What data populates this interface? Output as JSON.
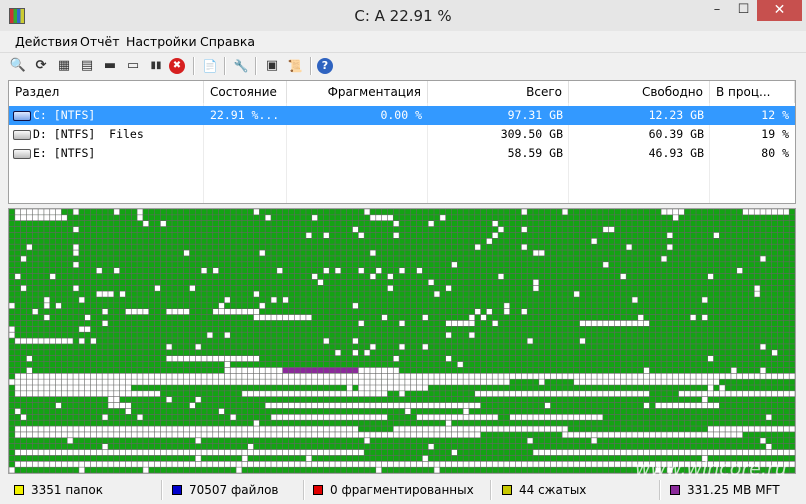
{
  "window": {
    "title": "C:  A  22.91 %",
    "minimize_glyph": "–",
    "maximize_glyph": "☐",
    "close_glyph": "✕"
  },
  "menu": [
    "Действия",
    "Отчёт",
    "Настройки",
    "Справка"
  ],
  "toolbar": {
    "icons": [
      "search-icon",
      "refresh-icon",
      "defrag-icon",
      "optimize-icon",
      "mft-icon",
      "stop-icon",
      "pause-icon",
      "cancel-icon",
      "report-icon",
      "settings-wrench-icon",
      "console-icon",
      "script-icon",
      "help-icon"
    ],
    "glyphs": [
      "🔍",
      "⟳",
      "▦",
      "▤",
      "▬",
      "▭",
      "▮▮",
      "✖",
      "📄",
      "🔧",
      "▣",
      "📜",
      "?"
    ]
  },
  "volumes": {
    "columns": [
      "Раздел",
      "Состояние",
      "Фрагментация",
      "Всего",
      "Свободно",
      "В проц..."
    ],
    "rows": [
      [
        "C: [NTFS]",
        "22.91 %...",
        "0.00 %",
        "97.31 GB",
        "12.23 GB",
        "12 %"
      ],
      [
        "D: [NTFS]  Files",
        "",
        "",
        "309.50 GB",
        "60.39 GB",
        "19 %"
      ],
      [
        "E: [NTFS]",
        "",
        "",
        "58.59 GB",
        "46.93 GB",
        "80 %"
      ]
    ]
  },
  "cluster_map": {
    "cols": 135,
    "rows": 45,
    "colors": {
      "used": "#13a313",
      "free": "#ffffff",
      "fragmented": "#c00000",
      "compressed": "#c8c800",
      "mft": "#8a2a9a",
      "grid": "#666666"
    }
  },
  "status": {
    "items": [
      {
        "text": "3351 папок",
        "color": "#f2f200"
      },
      {
        "text": "70507 файлов",
        "color": "#0000cc"
      },
      {
        "text": "0 фрагментированных",
        "color": "#e00000"
      },
      {
        "text": "44 сжатых",
        "color": "#c8c800"
      },
      {
        "text": "331.25 MB MFT",
        "color": "#8a2a9a"
      }
    ]
  },
  "watermark": "www.wincore.ru"
}
